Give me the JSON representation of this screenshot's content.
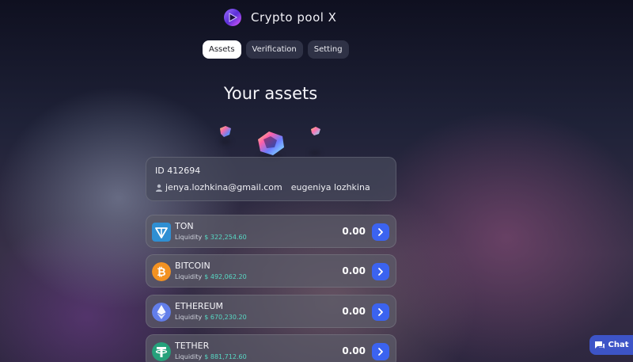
{
  "app": {
    "title": "Crypto pool X"
  },
  "tabs": [
    {
      "label": "Assets",
      "active": true
    },
    {
      "label": "Verification",
      "active": false
    },
    {
      "label": "Setting",
      "active": false
    }
  ],
  "page": {
    "title": "Your assets"
  },
  "profile": {
    "id": "ID 412694",
    "email": "jenya.lozhkina@gmail.com",
    "name": "eugeniya lozhkina"
  },
  "assets": [
    {
      "name": "TON",
      "liquidity_label": "Liquidity",
      "liquidity": "$ 322,254.60",
      "balance": "0.00",
      "icon": "ton-icon",
      "color": "#2f8fd3"
    },
    {
      "name": "BITCOIN",
      "liquidity_label": "Liquidity",
      "liquidity": "$ 492,062.20",
      "balance": "0.00",
      "icon": "bitcoin-icon",
      "color": "#f39222"
    },
    {
      "name": "ETHEREUM",
      "liquidity_label": "Liquidity",
      "liquidity": "$ 670,230.20",
      "balance": "0.00",
      "icon": "ethereum-icon",
      "color": "#627eea"
    },
    {
      "name": "TETHER",
      "liquidity_label": "Liquidity",
      "liquidity": "$ 881,712.60",
      "balance": "0.00",
      "icon": "tether-icon",
      "color": "#26a17b"
    }
  ],
  "chat": {
    "label": "Chat",
    "icon": "chat-icon"
  },
  "colors": {
    "accent": "#3b63f0",
    "liquidity": "#57d9c4"
  }
}
